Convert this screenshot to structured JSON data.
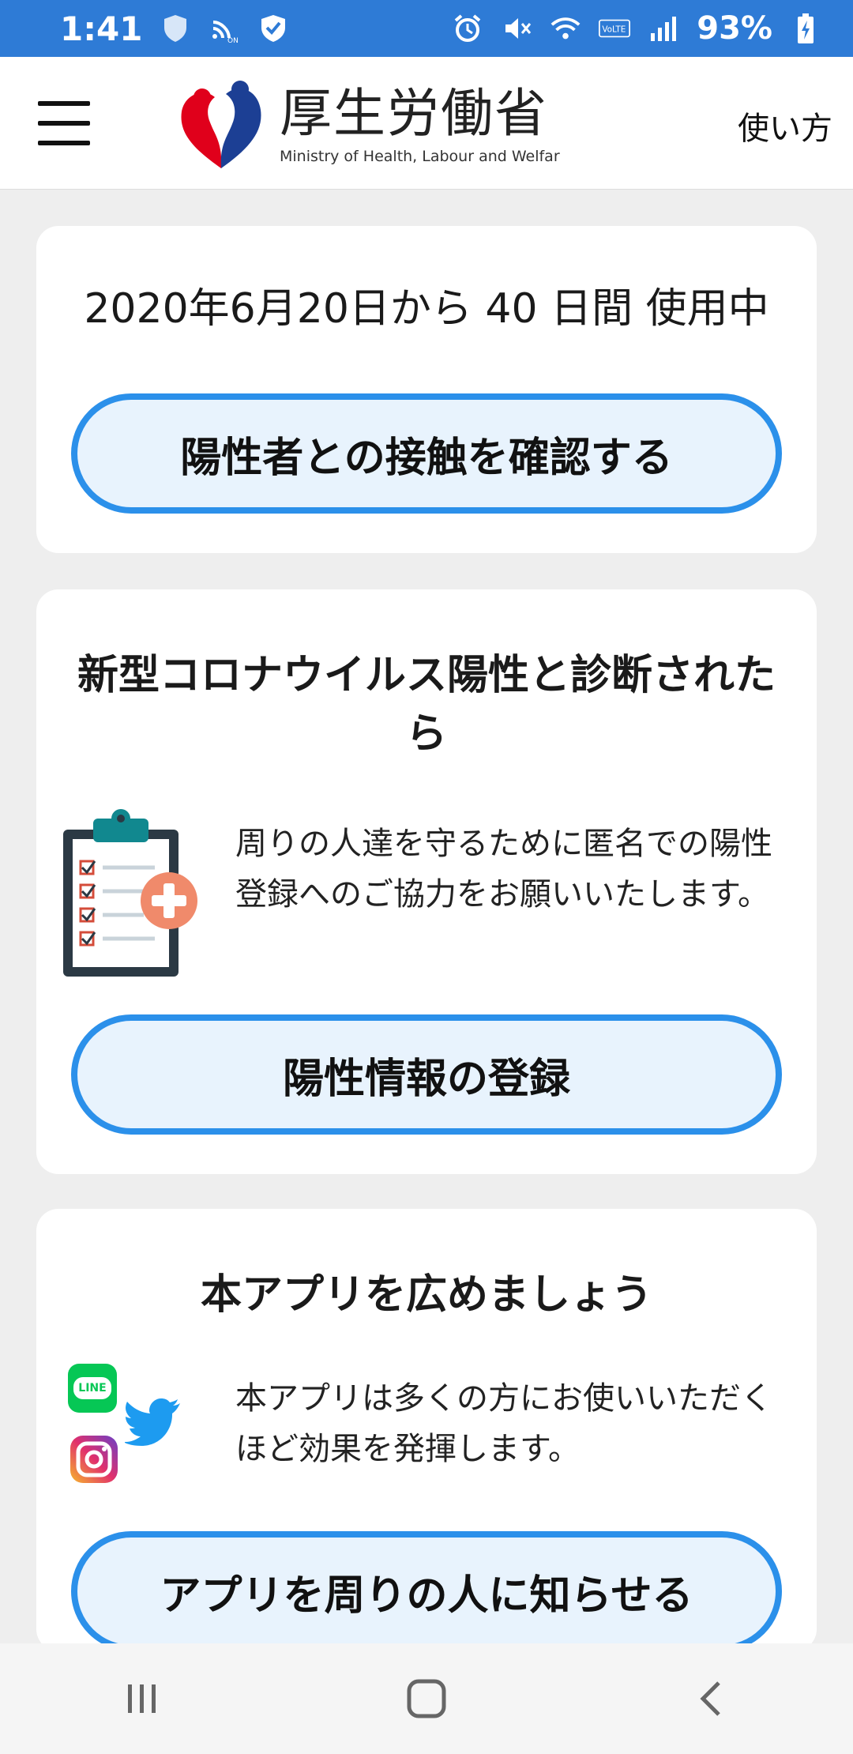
{
  "status_bar": {
    "time": "1:41",
    "battery": "93%"
  },
  "header": {
    "logo_title": "厚生労働省",
    "logo_subtitle": "Ministry of Health, Labour and Welfar",
    "howto_label": "使い方"
  },
  "usage_card": {
    "usage_text": "2020年6月20日から 40 日間 使用中",
    "check_contact_label": "陽性者との接触を確認する"
  },
  "positive_card": {
    "heading": "新型コロナウイルス陽性と診断されたら",
    "body": "周りの人達を守るために匿名での陽性登録へのご協力をお願いいたします。",
    "register_label": "陽性情報の登録"
  },
  "share_card": {
    "heading": "本アプリを広めましょう",
    "body": "本アプリは多くの方にお使いいただくほど効果を発揮します。",
    "share_label": "アプリを周りの人に知らせる",
    "line_badge": "LINE"
  },
  "colors": {
    "status_bar": "#2e7bd6",
    "button_border": "#2b90ea",
    "button_fill": "#e8f3fd"
  }
}
